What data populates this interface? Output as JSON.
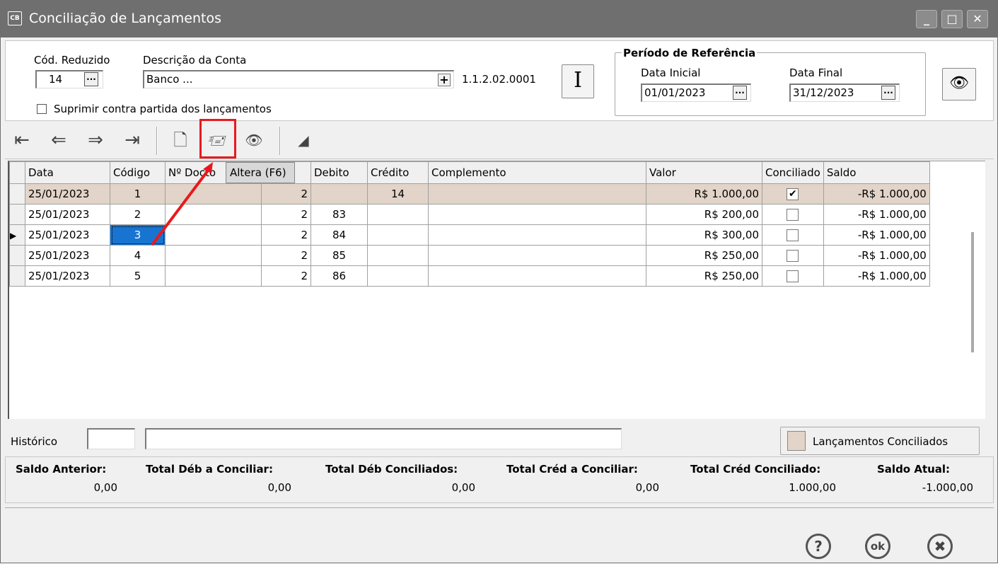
{
  "window": {
    "title": "Conciliação de Lançamentos",
    "icon_text": "CB",
    "controls": [
      "minimize-icon",
      "maximize-icon",
      "close-icon"
    ]
  },
  "form": {
    "cod_reduzido_label": "Cód. Reduzido",
    "cod_reduzido_value": "14",
    "descricao_label": "Descrição da Conta",
    "descricao_value": "Banco ...",
    "account_code": "1.1.2.02.0001",
    "suprimir_label": "Suprimir contra partida dos lançamentos",
    "periodo_title": "Período de Referência",
    "data_inicial_label": "Data Inicial",
    "data_inicial_value": "01/01/2023",
    "data_final_label": "Data Final",
    "data_final_value": "31/12/2023",
    "ellipsis": "...",
    "plus": "+",
    "info_button": "I"
  },
  "toolbar": {
    "buttons": [
      "first-icon",
      "prev-icon",
      "next-icon",
      "last-icon",
      "new-icon",
      "edit-icon",
      "view-icon",
      "eraser-icon"
    ],
    "tooltip": "Altera (F6)"
  },
  "grid": {
    "columns": [
      "Data",
      "Código",
      "Nº Docto",
      "",
      "Debito",
      "Crédito",
      "Complemento",
      "Valor",
      "Conciliado",
      "Saldo"
    ],
    "rows": [
      {
        "data": "25/01/2023",
        "codigo": "1",
        "docto": "",
        "n": "2",
        "debito": "",
        "credito": "14",
        "complemento": "",
        "valor": "R$ 1.000,00",
        "conciliado": true,
        "saldo": "-R$ 1.000,00"
      },
      {
        "data": "25/01/2023",
        "codigo": "2",
        "docto": "",
        "n": "2",
        "debito": "83",
        "credito": "",
        "complemento": "",
        "valor": "R$ 200,00",
        "conciliado": false,
        "saldo": "-R$ 1.000,00"
      },
      {
        "data": "25/01/2023",
        "codigo": "3",
        "docto": "",
        "n": "2",
        "debito": "84",
        "credito": "",
        "complemento": "",
        "valor": "R$ 300,00",
        "conciliado": false,
        "saldo": "-R$ 1.000,00"
      },
      {
        "data": "25/01/2023",
        "codigo": "4",
        "docto": "",
        "n": "2",
        "debito": "85",
        "credito": "",
        "complemento": "",
        "valor": "R$ 250,00",
        "conciliado": false,
        "saldo": "-R$ 1.000,00"
      },
      {
        "data": "25/01/2023",
        "codigo": "5",
        "docto": "",
        "n": "2",
        "debito": "86",
        "credito": "",
        "complemento": "",
        "valor": "R$ 250,00",
        "conciliado": false,
        "saldo": "-R$ 1.000,00"
      }
    ],
    "check_mark": "✔"
  },
  "historico": {
    "label": "Histórico",
    "legend_label": "Lançamentos Conciliados",
    "legend_color": "#e2d4c8"
  },
  "totals": [
    {
      "label": "Saldo Anterior:",
      "value": "0,00"
    },
    {
      "label": "Total Déb a Conciliar:",
      "value": "0,00"
    },
    {
      "label": "Total Déb Conciliados:",
      "value": "0,00"
    },
    {
      "label": "Total Créd a Conciliar:",
      "value": "0,00"
    },
    {
      "label": "Total Créd Conciliado:",
      "value": "1.000,00"
    },
    {
      "label": "Saldo Atual:",
      "value": "-1.000,00"
    }
  ],
  "footer": {
    "help": "?",
    "ok": "ok",
    "cancel": "✖"
  },
  "colors": {
    "highlight": "#e8191e",
    "selected": "#1874d1",
    "titlebar": "#6f6f6f"
  }
}
